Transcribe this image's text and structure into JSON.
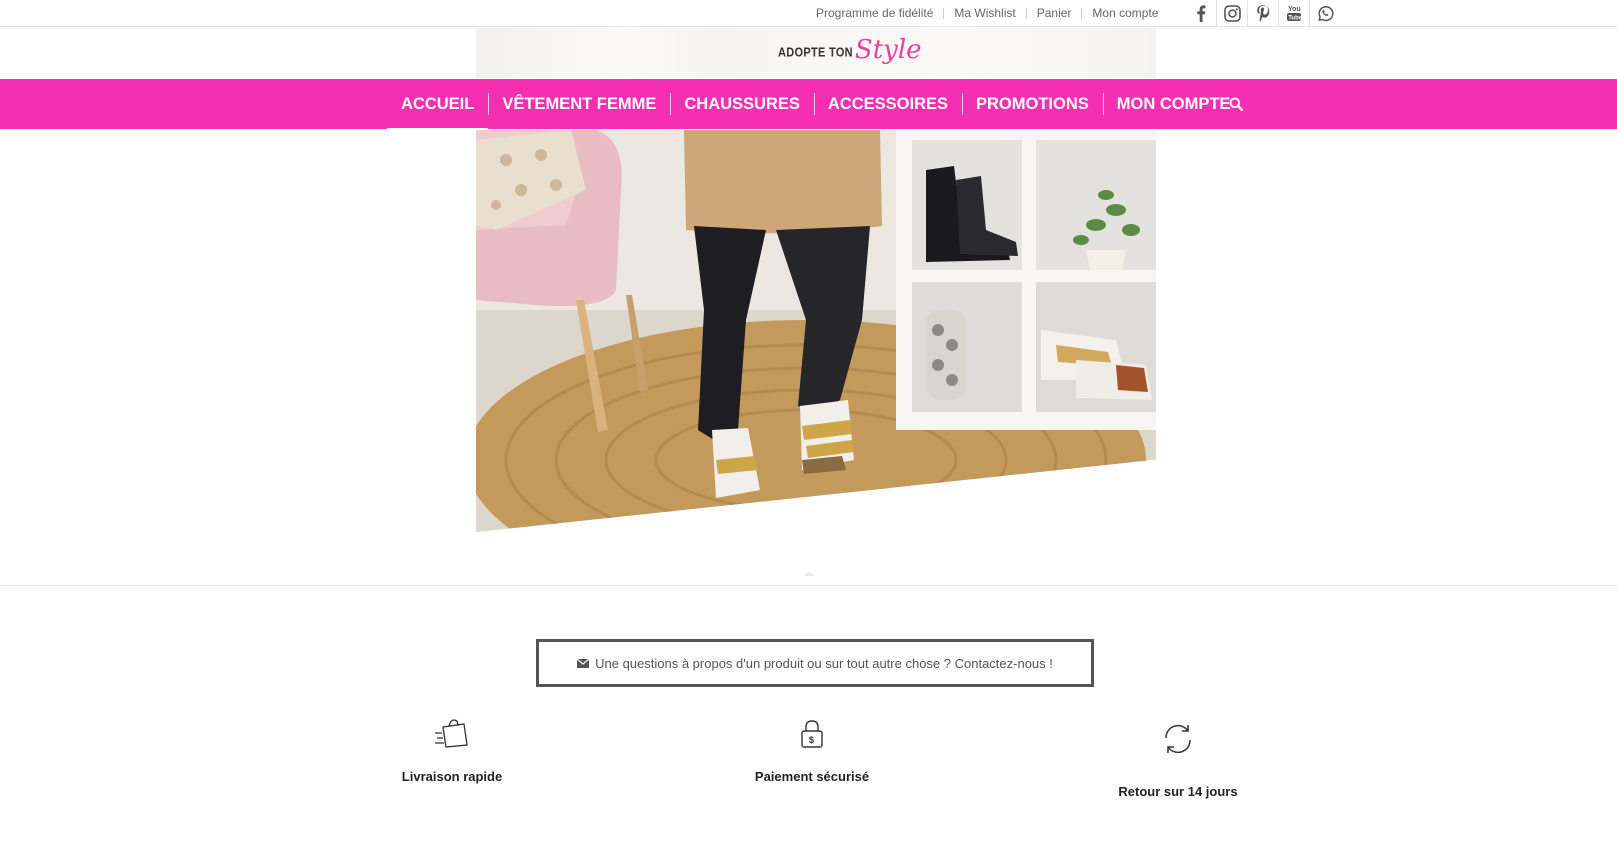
{
  "topbar": {
    "links": [
      {
        "label": "Programme de fidélité"
      },
      {
        "label": "Ma Wishlist"
      },
      {
        "label": "Panier"
      },
      {
        "label": "Mon compte"
      }
    ],
    "social_icons": [
      "facebook-icon",
      "instagram-icon",
      "pinterest-icon",
      "youtube-icon",
      "whatsapp-icon"
    ]
  },
  "logo": {
    "text_small": "ADOPTE TON",
    "text_script": "Style"
  },
  "nav": {
    "items": [
      {
        "label": "ACCUEIL",
        "active": true
      },
      {
        "label": "VÊTEMENT FEMME"
      },
      {
        "label": "CHAUSSURES"
      },
      {
        "label": "ACCESSOIRES"
      },
      {
        "label": "PROMOTIONS"
      },
      {
        "label": "MON COMPTE"
      }
    ],
    "search_icon": "search-icon"
  },
  "contact": {
    "icon": "envelope-icon",
    "label": "Une questions à propos d'un produit ou sur tout autre chose ? Contactez-nous !"
  },
  "features": [
    {
      "icon": "fast-delivery-bag-icon",
      "label": "Livraison rapide"
    },
    {
      "icon": "secure-lock-icon",
      "label": "Paiement sécurisé"
    },
    {
      "icon": "return-arrows-icon",
      "label": "Retour sur 14 jours"
    }
  ],
  "colors": {
    "brand_pink": "#f52fb2",
    "logo_pink": "#ef3ba4",
    "text_gray": "#666666"
  }
}
